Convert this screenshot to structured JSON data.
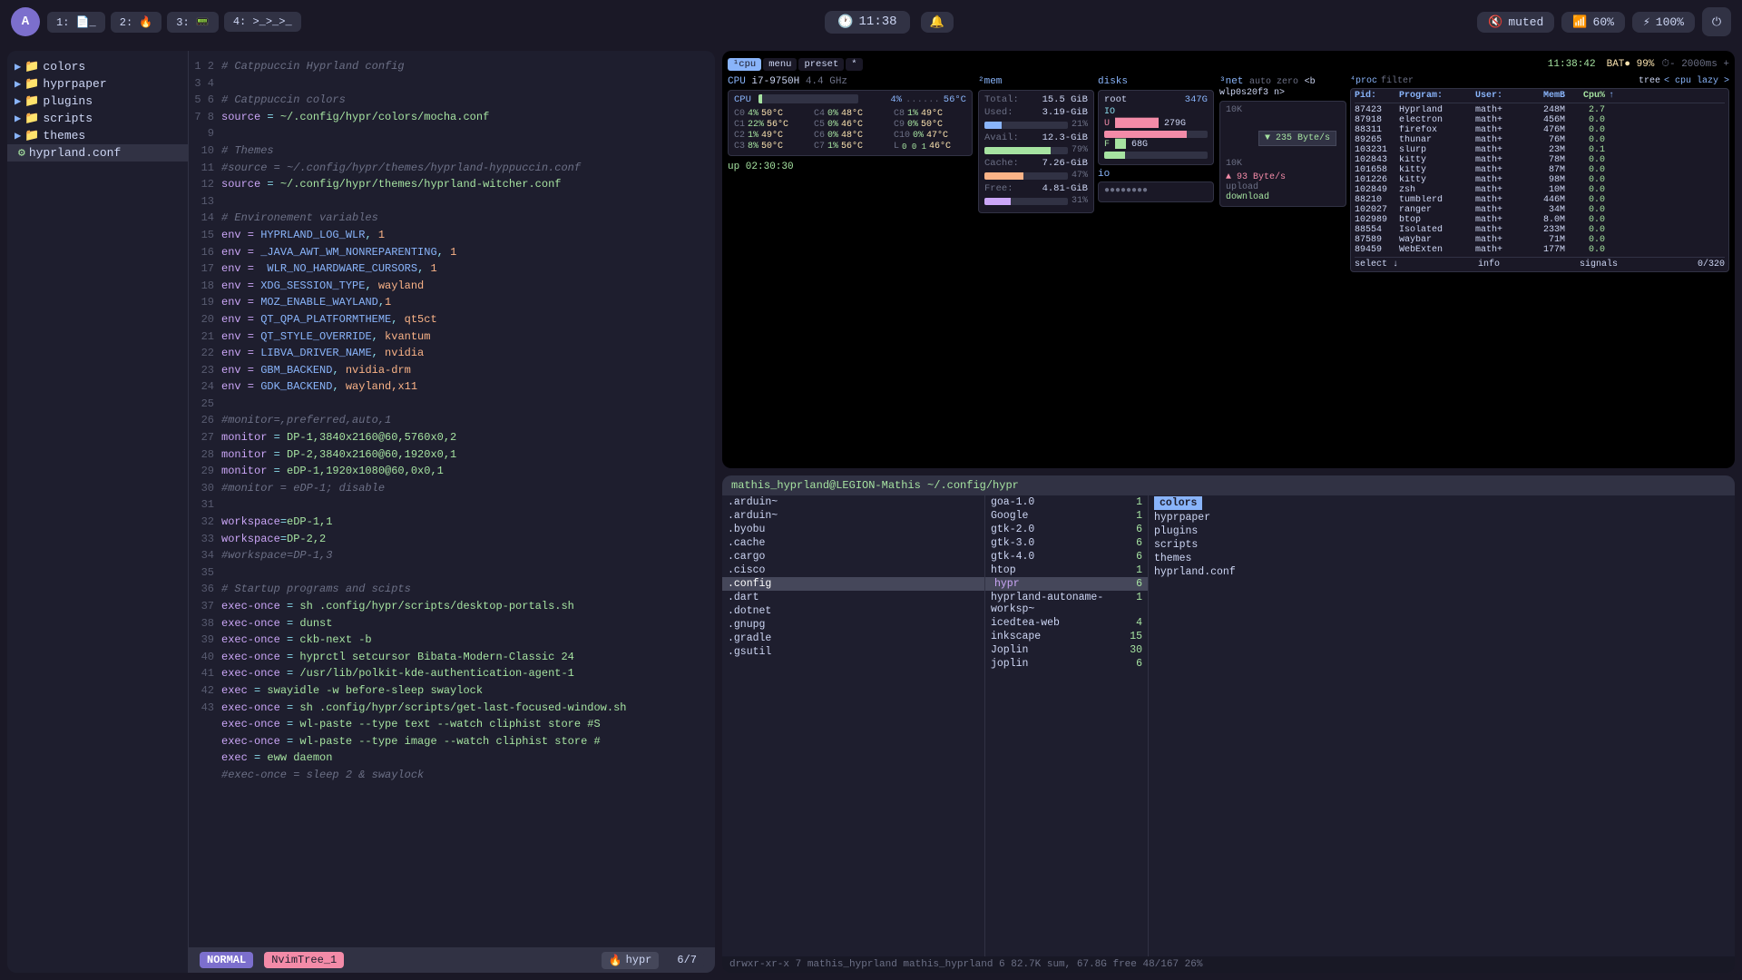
{
  "topbar": {
    "logo": "A",
    "workspaces": [
      {
        "id": "1",
        "label": "1: 📄_",
        "active": false
      },
      {
        "id": "2",
        "label": "2: 🔥",
        "active": false
      },
      {
        "id": "3",
        "label": "3: 📟",
        "active": false
      },
      {
        "id": "4",
        "label": "4: >_>_>_",
        "active": false
      }
    ],
    "clock": "11:38",
    "muted": "muted",
    "volume": "60%",
    "battery": "100%"
  },
  "filetree": {
    "items": [
      {
        "name": "colors",
        "type": "folder",
        "indent": 0
      },
      {
        "name": "hyprpaper",
        "type": "folder",
        "indent": 0
      },
      {
        "name": "plugins",
        "type": "folder",
        "indent": 0
      },
      {
        "name": "scripts",
        "type": "folder",
        "indent": 0
      },
      {
        "name": "themes",
        "type": "folder",
        "indent": 0
      },
      {
        "name": "hyprland.conf",
        "type": "file",
        "indent": 0,
        "active": true
      }
    ]
  },
  "editor": {
    "filename": "hypr",
    "position": "6/7"
  },
  "statusbar": {
    "mode": "NORMAL",
    "branch": "NvimTree_1",
    "filename": "hypr",
    "position": "6/7"
  },
  "htop": {
    "tabs": [
      "cpu",
      "menu",
      "preset",
      "*"
    ],
    "cpu_label": "i7-9750H",
    "bat": "BAT● 99%",
    "interval": "2000ms",
    "freq": "4.4 GHz",
    "uptime": "up 02:30:30",
    "cores": [
      {
        "id": "C0",
        "pct": 4,
        "temp": "50°C",
        "id2": "C4",
        "pct2": 0,
        "temp2": "48°C",
        "id3": "C8",
        "pct3": 1,
        "temp3": "49°C"
      },
      {
        "id": "C1",
        "pct": 22,
        "temp": "56°C",
        "id2": "C5",
        "pct2": 0,
        "temp2": "46°C",
        "id3": "C9",
        "pct3": 0,
        "temp3": "50°C"
      },
      {
        "id": "C2",
        "pct": 1,
        "temp": "49°C",
        "id2": "C6",
        "pct2": 0,
        "temp2": "48°C",
        "id3": "C10",
        "pct3": 0,
        "temp3": "47°C"
      },
      {
        "id": "C3",
        "pct": 8,
        "temp": "50°C",
        "id2": "C7",
        "pct2": 1,
        "temp2": "56°C",
        "id3": "L",
        "pct3": 0,
        "temp3": "0 0 1  46°C"
      }
    ],
    "cpu_overall_pct": 4,
    "cpu_overall_temp": "56°C",
    "mem": {
      "total": "15.5 GiB",
      "used": "3.19-GiB",
      "used_pct": 21,
      "avail": "12.3-GiB",
      "avail_pct": 79,
      "cache": "7.26-GiB",
      "cache_pct": 47,
      "free": "4.81-GiB",
      "free_pct": 31
    },
    "disks": {
      "root": "347G",
      "io_label": "IO",
      "used": "279G",
      "used_pct": 80,
      "free": "68G",
      "free_pct": 20
    },
    "io": {
      "label": "io",
      "bars": "●●●●●●●●"
    },
    "net": {
      "interface": "wlp0s20f3",
      "mode": "auto zero",
      "download": "235 Byte/s",
      "upload": "93 Byte/s",
      "graph_max": "10K"
    },
    "proc": {
      "filter": "",
      "tree_mode": "cpu lazy",
      "count": "0/320",
      "headers": [
        "Pid:",
        "Program:",
        "User:",
        "MemB",
        "Cpu%"
      ],
      "rows": [
        {
          "pid": "87423",
          "prog": "Hyprland",
          "user": "math+",
          "memb": "248M",
          "cpu": "2.7"
        },
        {
          "pid": "87918",
          "prog": "electron",
          "user": "math+",
          "memb": "456M",
          "cpu": "0.0"
        },
        {
          "pid": "88311",
          "prog": "firefox",
          "user": "math+",
          "memb": "476M",
          "cpu": "0.0"
        },
        {
          "pid": "89265",
          "prog": "thunar",
          "user": "math+",
          "memb": "76M",
          "cpu": "0.0"
        },
        {
          "pid": "103231",
          "prog": "slurp",
          "user": "math+",
          "memb": "23M",
          "cpu": "0.1"
        },
        {
          "pid": "102843",
          "prog": "kitty",
          "user": "math+",
          "memb": "78M",
          "cpu": "0.0"
        },
        {
          "pid": "101658",
          "prog": "kitty",
          "user": "math+",
          "memb": "87M",
          "cpu": "0.0"
        },
        {
          "pid": "101226",
          "prog": "kitty",
          "user": "math+",
          "memb": "98M",
          "cpu": "0.0"
        },
        {
          "pid": "102849",
          "prog": "zsh",
          "user": "math+",
          "memb": "10M",
          "cpu": "0.0"
        },
        {
          "pid": "88210",
          "prog": "tumblerd",
          "user": "math+",
          "memb": "446M",
          "cpu": "0.0"
        },
        {
          "pid": "102027",
          "prog": "ranger",
          "user": "math+",
          "memb": "34M",
          "cpu": "0.0"
        },
        {
          "pid": "102989",
          "prog": "btop",
          "user": "math+",
          "memb": "8.0M",
          "cpu": "0.0"
        },
        {
          "pid": "88554",
          "prog": "Isolated",
          "user": "math+",
          "memb": "233M",
          "cpu": "0.0"
        },
        {
          "pid": "87589",
          "prog": "waybar",
          "user": "math+",
          "memb": "71M",
          "cpu": "0.0"
        },
        {
          "pid": "89459",
          "prog": "WebExten",
          "user": "math+",
          "memb": "177M",
          "cpu": "0.0"
        }
      ]
    }
  },
  "terminal": {
    "title": "mathis_hyprland@LEGION-Mathis ~/.config/hypr",
    "left_col": {
      "items": [
        {
          "name": ".arduin~",
          "selected": false
        },
        {
          "name": ".arduin~",
          "selected": false
        },
        {
          "name": ".byobu",
          "selected": false
        },
        {
          "name": ".cache",
          "selected": false
        },
        {
          "name": ".cargo",
          "selected": false
        },
        {
          "name": ".cisco",
          "selected": false
        },
        {
          "name": ".config",
          "selected": true,
          "highlighted": true
        },
        {
          "name": ".dart",
          "selected": false
        },
        {
          "name": ".dotnet",
          "selected": false
        },
        {
          "name": ".gnupg",
          "selected": false
        },
        {
          "name": ".gradle",
          "selected": false
        },
        {
          "name": ".gsutil",
          "selected": false
        }
      ]
    },
    "mid_col": {
      "header": "",
      "items": [
        {
          "name": "goa-1.0",
          "num": "1"
        },
        {
          "name": "Google",
          "num": "1"
        },
        {
          "name": "gtk-2.0",
          "num": "6"
        },
        {
          "name": "gtk-3.0",
          "num": "6"
        },
        {
          "name": "gtk-4.0",
          "num": "6"
        },
        {
          "name": "htop",
          "num": "1"
        },
        {
          "name": "hypr",
          "num": "6",
          "selected": true,
          "highlighted": true
        },
        {
          "name": "hyprland-autoname-worksp~",
          "num": "1"
        },
        {
          "name": "icedtea-web",
          "num": "4"
        },
        {
          "name": "inkscape",
          "num": "15"
        },
        {
          "name": "Joplin",
          "num": "30"
        },
        {
          "name": "joplin",
          "num": "6"
        }
      ]
    },
    "right_col": {
      "items": [
        {
          "name": "colors",
          "selected": true
        },
        {
          "name": "hyprpaper",
          "selected": false
        },
        {
          "name": "plugins",
          "selected": false
        },
        {
          "name": "scripts",
          "selected": false
        },
        {
          "name": "themes",
          "selected": false
        },
        {
          "name": "hyprland.conf",
          "selected": false
        }
      ]
    },
    "statusbar": "drwxr-xr-x 7 mathis_hyprland mathis_hyprland 6 82.7K sum, 67.8G free  48/167  26%"
  },
  "editor_lines": [
    {
      "n": 1,
      "text": "# Catppuccin Hyprland config",
      "type": "comment"
    },
    {
      "n": 2,
      "text": ""
    },
    {
      "n": 3,
      "text": "# Catppuccin colors",
      "type": "comment"
    },
    {
      "n": 4,
      "text": "source = ~/.config/hypr/colors/mocha.conf",
      "type": "code"
    },
    {
      "n": 5,
      "text": ""
    },
    {
      "n": 6,
      "text": "# Themes",
      "type": "comment"
    },
    {
      "n": 7,
      "text": "#source = ~/.config/hypr/themes/hyprland-hyppuccin.conf",
      "type": "comment"
    },
    {
      "n": 8,
      "text": "source = ~/.config/hypr/themes/hyprland-witcher.conf",
      "type": "code"
    },
    {
      "n": 9,
      "text": ""
    },
    {
      "n": 10,
      "text": "# Environement variables",
      "type": "comment"
    },
    {
      "n": 11,
      "text": "env = HYPRLAND_LOG_WLR, 1",
      "type": "env"
    },
    {
      "n": 12,
      "text": "env = _JAVA_AWT_WM_NONREPARENTING, 1",
      "type": "env"
    },
    {
      "n": 13,
      "text": "env =  WLR_NO_HARDWARE_CURSORS, 1",
      "type": "env"
    },
    {
      "n": 14,
      "text": "env = XDG_SESSION_TYPE, wayland",
      "type": "env"
    },
    {
      "n": 15,
      "text": "env = MOZ_ENABLE_WAYLAND,1",
      "type": "env"
    },
    {
      "n": 16,
      "text": "env = QT_QPA_PLATFORMTHEME, qt5ct",
      "type": "env"
    },
    {
      "n": 17,
      "text": "env = QT_STYLE_OVERRIDE, kvantum",
      "type": "env"
    },
    {
      "n": 18,
      "text": "env = LIBVA_DRIVER_NAME, nvidia",
      "type": "env"
    },
    {
      "n": 19,
      "text": "env = GBM_BACKEND, nvidia-drm",
      "type": "env"
    },
    {
      "n": 20,
      "text": "env = GDK_BACKEND, wayland,x11",
      "type": "env"
    },
    {
      "n": 21,
      "text": ""
    },
    {
      "n": 22,
      "text": "#monitor=,preferred,auto,1",
      "type": "comment"
    },
    {
      "n": 23,
      "text": "monitor = DP-1,3840x2160@60,5760x0,2",
      "type": "code"
    },
    {
      "n": 24,
      "text": "monitor = DP-2,3840x2160@60,1920x0,1",
      "type": "code"
    },
    {
      "n": 25,
      "text": "monitor = eDP-1,1920x1080@60,0x0,1",
      "type": "code"
    },
    {
      "n": 26,
      "text": "#monitor = eDP-1; disable",
      "type": "comment"
    },
    {
      "n": 27,
      "text": ""
    },
    {
      "n": 28,
      "text": "workspace=eDP-1,1",
      "type": "code"
    },
    {
      "n": 29,
      "text": "workspace=DP-2,2",
      "type": "code"
    },
    {
      "n": 30,
      "text": "#workspace=DP-1,3",
      "type": "comment"
    },
    {
      "n": 31,
      "text": ""
    },
    {
      "n": 32,
      "text": "# Startup programs and scipts",
      "type": "comment"
    },
    {
      "n": 33,
      "text": "exec-once = sh .config/hypr/scripts/desktop-portals.sh",
      "type": "code"
    },
    {
      "n": 34,
      "text": "exec-once = dunst",
      "type": "code"
    },
    {
      "n": 35,
      "text": "exec-once = ckb-next -b",
      "type": "code"
    },
    {
      "n": 36,
      "text": "exec-once = hyprctl setcursor Bibata-Modern-Classic 24",
      "type": "code"
    },
    {
      "n": 37,
      "text": "exec-once = /usr/lib/polkit-kde-authentication-agent-1",
      "type": "code"
    },
    {
      "n": 38,
      "text": "exec = swayidle -w before-sleep swaylock",
      "type": "code"
    },
    {
      "n": 39,
      "text": "exec-once = sh .config/hypr/scripts/get-last-focused-window.sh",
      "type": "code"
    },
    {
      "n": 40,
      "text": "exec-once = wl-paste --type text --watch cliphist store #S",
      "type": "code"
    },
    {
      "n": 41,
      "text": "exec-once = wl-paste --type image --watch cliphist store #",
      "type": "code"
    },
    {
      "n": 42,
      "text": "exec = eww daemon",
      "type": "code"
    },
    {
      "n": 43,
      "text": "#exec-once = sleep 2 & swaylock",
      "type": "comment"
    }
  ]
}
